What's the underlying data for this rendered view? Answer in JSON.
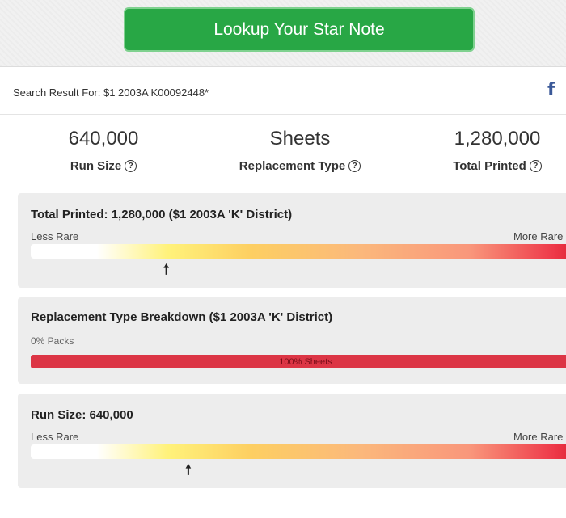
{
  "header": {
    "lookup_button": "Lookup Your Star Note"
  },
  "search": {
    "result_text": "Search Result For: $1 2003A K00092448*"
  },
  "social": {
    "facebook_glyph": "f"
  },
  "stats": [
    {
      "value": "640,000",
      "label": "Run Size"
    },
    {
      "value": "Sheets",
      "label": "Replacement Type"
    },
    {
      "value": "1,280,000",
      "label": "Total Printed"
    }
  ],
  "help_glyph": "?",
  "panels": {
    "total_printed": {
      "title": "Total Printed: 1,280,000 ($1 2003A 'K' District)",
      "left_label": "Less Rare",
      "right_label": "More Rare",
      "arrow": "🠕",
      "position_fraction": 0.25
    },
    "replacement": {
      "title": "Replacement Type Breakdown ($1 2003A 'K' District)",
      "packs_label": "0% Packs",
      "sheets_label": "100% Sheets",
      "sheets_percent": 100
    },
    "run_size": {
      "title": "Run Size: 640,000",
      "left_label": "Less Rare",
      "right_label": "More Rare",
      "arrow": "🠕",
      "position_fraction": 0.29
    }
  },
  "colors": {
    "button_green": "#28a745",
    "facebook_blue": "#3b5998",
    "sheets_red": "#dc3545"
  }
}
